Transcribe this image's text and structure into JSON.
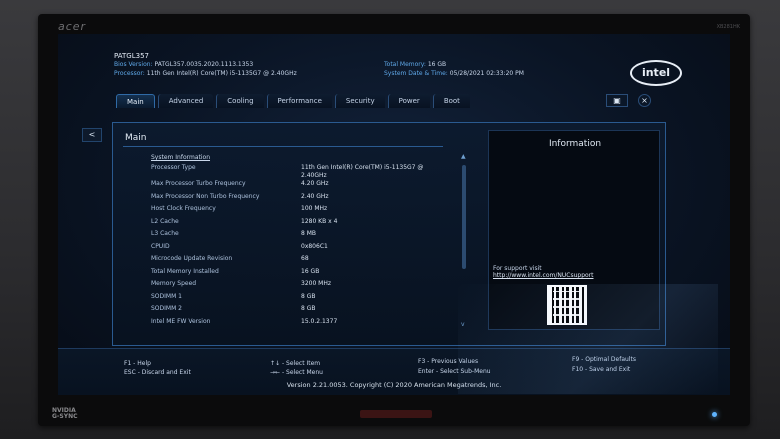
{
  "monitor": {
    "brand": "acer",
    "model": "XB281HK",
    "gsync_brand": "NVIDIA",
    "gsync_label": "G-SYNC"
  },
  "header": {
    "hostname": "PATGL357",
    "bios_version_label": "Bios Version:",
    "bios_version": "PATGL357.0035.2020.1113.1353",
    "processor_label": "Processor:",
    "processor": "11th Gen Intel(R) Core(TM) i5-1135G7 @ 2.40GHz",
    "total_memory_label": "Total Memory:",
    "total_memory": "16 GB",
    "system_datetime_label": "System Date & Time:",
    "system_date": "05/28/2021",
    "system_time": "02:33:20 PM",
    "logo_text": "intel"
  },
  "tabs": [
    {
      "label": "Main",
      "active": true
    },
    {
      "label": "Advanced",
      "active": false
    },
    {
      "label": "Cooling",
      "active": false
    },
    {
      "label": "Performance",
      "active": false
    },
    {
      "label": "Security",
      "active": false
    },
    {
      "label": "Power",
      "active": false
    },
    {
      "label": "Boot",
      "active": false
    }
  ],
  "toolbar": {
    "save_icon": "save-icon",
    "exit_icon": "close-circle-icon"
  },
  "back_label": "<",
  "main": {
    "title": "Main",
    "section": "System Information",
    "rows": [
      {
        "key": "Processor Type",
        "value": "11th Gen Intel(R) Core(TM) i5-1135G7 @ 2.40GHz"
      },
      {
        "key": "Max Processor Turbo Frequency",
        "value": "4.20 GHz"
      },
      {
        "key": "Max Processor Non Turbo Frequency",
        "value": "2.40 GHz"
      },
      {
        "key": "Host Clock Frequency",
        "value": "100 MHz"
      },
      {
        "key": "L2 Cache",
        "value": "1280 KB x 4"
      },
      {
        "key": "L3 Cache",
        "value": "8 MB"
      },
      {
        "key": "CPUID",
        "value": "0x806C1"
      },
      {
        "key": "Microcode Update Revision",
        "value": "68"
      },
      {
        "key": "Total Memory Installed",
        "value": "16 GB"
      },
      {
        "key": "Memory Speed",
        "value": "3200 MHz"
      },
      {
        "key": "SODIMM 1",
        "value": "8 GB"
      },
      {
        "key": "SODIMM 2",
        "value": "8 GB"
      },
      {
        "key": "Intel ME FW Version",
        "value": "15.0.2.1377"
      }
    ]
  },
  "info": {
    "title": "Information",
    "support_text": "For support visit",
    "support_link": "http://www.intel.com/NUCsupport"
  },
  "help": {
    "f1": "F1 - Help",
    "esc": "ESC - Discard and Exit",
    "select_item": "↑↓ - Select Item",
    "select_menu": "→← - Select Menu",
    "f3": "F3 - Previous Values",
    "enter": "Enter - Select Sub-Menu",
    "f9": "F9 - Optimal Defaults",
    "f10": "F10 - Save and Exit"
  },
  "footer": {
    "copyright": "Version 2.21.0053. Copyright (C) 2020 American Megatrends, Inc."
  }
}
